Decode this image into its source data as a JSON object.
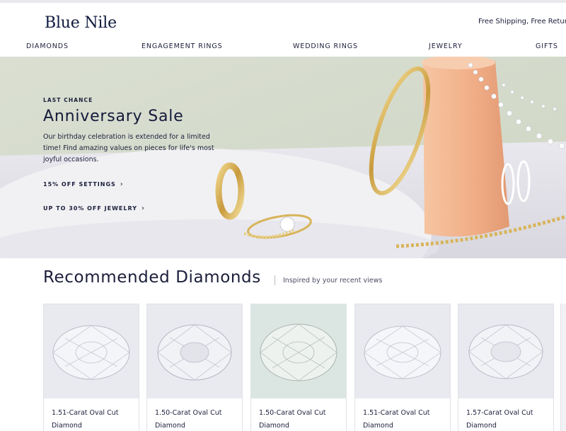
{
  "header": {
    "logo": "Blue Nile",
    "promo": "Free Shipping, Free Returns"
  },
  "nav": {
    "items": [
      "DIAMONDS",
      "ENGAGEMENT RINGS",
      "WEDDING RINGS",
      "JEWELRY",
      "GIFTS"
    ]
  },
  "hero": {
    "eyebrow": "LAST CHANCE",
    "title": "Anniversary Sale",
    "description": "Our birthday celebration is extended for a limited time! Find amazing values on pieces for life's most joyful occasions.",
    "links": [
      "15% OFF SETTINGS",
      "UP TO 30% OFF JEWELRY"
    ]
  },
  "recommended": {
    "title": "Recommended Diamonds",
    "subtitle": "Inspired by your recent views",
    "products": [
      {
        "line1": "1.51-Carat Oval Cut",
        "line2": "Diamond"
      },
      {
        "line1": "1.50-Carat Oval Cut",
        "line2": "Diamond"
      },
      {
        "line1": "1.50-Carat Oval Cut",
        "line2": "Diamond"
      },
      {
        "line1": "1.51-Carat Oval Cut",
        "line2": "Diamond"
      },
      {
        "line1": "1.57-Carat Oval Cut",
        "line2": "Diamond"
      }
    ]
  },
  "colors": {
    "navy": "#1b1e3a",
    "hero_bg": "#dfe3d8",
    "gold": "#d8b45a",
    "vase": "#f2b48e"
  }
}
